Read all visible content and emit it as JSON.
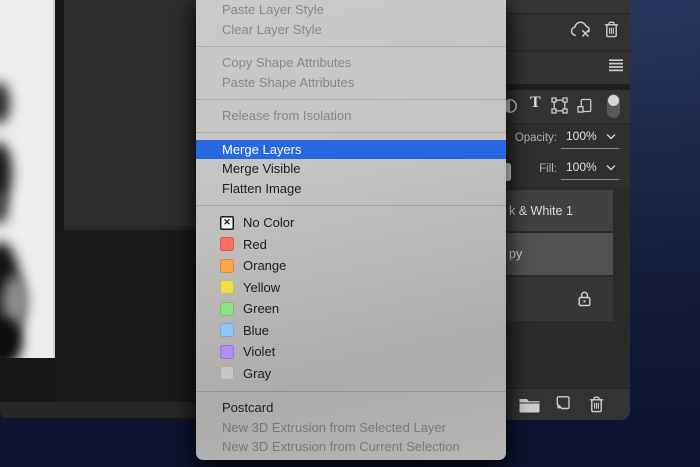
{
  "window": {
    "app": "Adobe Photoshop"
  },
  "context_menu": {
    "highlight_color": "#2767e2",
    "items": [
      {
        "type": "command",
        "label": "Paste Layer Style",
        "state": "disabled"
      },
      {
        "type": "command",
        "label": "Clear Layer Style",
        "state": "disabled"
      },
      {
        "type": "separator"
      },
      {
        "type": "command",
        "label": "Copy Shape Attributes",
        "state": "disabled"
      },
      {
        "type": "command",
        "label": "Paste Shape Attributes",
        "state": "disabled"
      },
      {
        "type": "separator"
      },
      {
        "type": "command",
        "label": "Release from Isolation",
        "state": "disabled"
      },
      {
        "type": "separator"
      },
      {
        "type": "command",
        "label": "Merge Layers",
        "state": "highlighted"
      },
      {
        "type": "command",
        "label": "Merge Visible",
        "state": "normal"
      },
      {
        "type": "command",
        "label": "Flatten Image",
        "state": "normal"
      },
      {
        "type": "separator"
      },
      {
        "type": "color",
        "label": "No Color",
        "swatch": "none"
      },
      {
        "type": "color",
        "label": "Red",
        "swatch": "#fd6e62"
      },
      {
        "type": "color",
        "label": "Orange",
        "swatch": "#fca54b"
      },
      {
        "type": "color",
        "label": "Yellow",
        "swatch": "#eedc4f"
      },
      {
        "type": "color",
        "label": "Green",
        "swatch": "#8ce085"
      },
      {
        "type": "color",
        "label": "Blue",
        "swatch": "#8fc6fa"
      },
      {
        "type": "color",
        "label": "Violet",
        "swatch": "#b18ff2"
      },
      {
        "type": "color",
        "label": "Gray",
        "swatch": "#c7c7c7"
      },
      {
        "type": "separator"
      },
      {
        "type": "command",
        "label": "Postcard",
        "state": "normal"
      },
      {
        "type": "command",
        "label": "New 3D Extrusion from Selected Layer",
        "state": "disabled"
      },
      {
        "type": "command",
        "label": "New 3D Extrusion from Current Selection",
        "state": "disabled"
      }
    ]
  },
  "layers_panel": {
    "opacity_label": "Opacity:",
    "opacity_value": "100%",
    "fill_label": "Fill:",
    "fill_value": "100%",
    "rows": [
      {
        "label": "k & White 1",
        "variant": "selected",
        "locked": false
      },
      {
        "label": "py",
        "variant": "active",
        "locked": false
      },
      {
        "label": "",
        "variant": "background",
        "locked": true
      }
    ]
  },
  "icons": {
    "no_color_glyph": "✕",
    "type_filter_glyph": "T"
  }
}
